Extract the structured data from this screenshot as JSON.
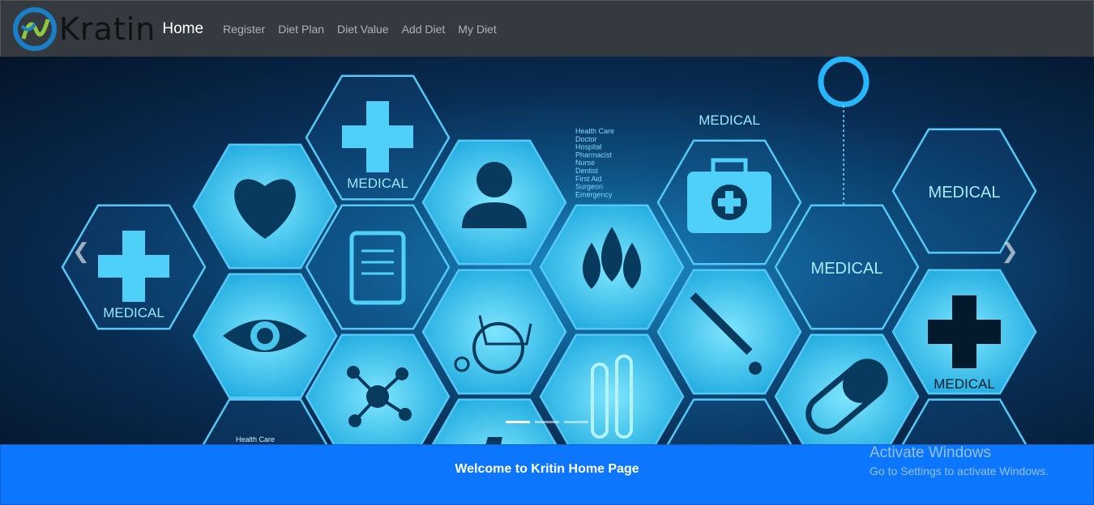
{
  "navbar": {
    "brand": "Kratin",
    "home": "Home",
    "links": [
      "Register",
      "Diet Plan",
      "Diet Value",
      "Add Diet",
      "My Diet"
    ]
  },
  "hero": {
    "labels": {
      "medical": "MEDICAL",
      "health_care": "Health Care"
    },
    "word_list": [
      "Health Care",
      "Doctor",
      "Hospital",
      "Pharmacist",
      "Nurse",
      "Dentist",
      "First Aid",
      "Surgeon",
      "Emergency"
    ],
    "prev_icon": "chevron-left-icon",
    "next_icon": "chevron-right-icon",
    "slides_count": 3,
    "active_slide": 1
  },
  "banner": {
    "text": "Welcome to Kritin Home Page"
  },
  "watermark": {
    "title": "Activate Windows",
    "subtitle": "Go to Settings to activate Windows."
  },
  "colors": {
    "navbar_bg": "#343a40",
    "banner_bg": "#0d76ff",
    "hex_fill": "#5fd3f5"
  }
}
